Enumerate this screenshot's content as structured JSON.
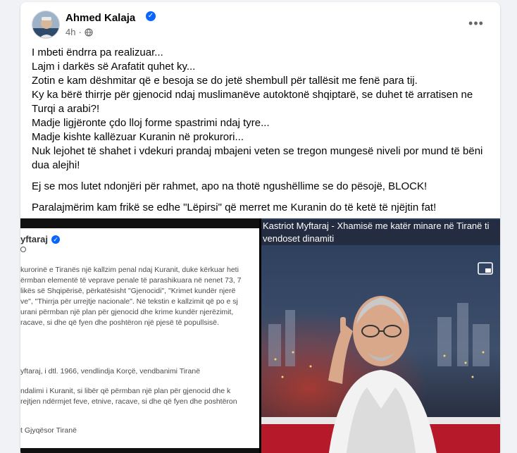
{
  "post": {
    "author": "Ahmed Kalaja",
    "time": "4h",
    "paragraphs": [
      "I mbeti ëndrra pa realizuar...",
      "Lajm i darkës së Arafatit quhet ky...",
      "Zotin e kam dëshmitar që e besoja se do jetë shembull për tallësit me fenë para tij.",
      "Ky ka bërë thirrje për gjenocid ndaj muslimanëve autoktonë shqiptarë, se duhet të arratisen ne Turqi a arabi?!",
      "Madje ligjëronte çdo lloj forme spastrimi ndaj tyre...",
      "Madje kishte kallëzuar Kuranin në prokurori...",
      "Nuk lejohet të shahet i vdekuri prandaj mbajeni veten se tregon mungesë niveli por mund të bëni dua alejhi!"
    ],
    "paragraph_block": "Ej se mos lutet ndonjëri për rahmet, apo na thotë ngushëllime se do pësojë, BLOCK!",
    "paragraph_final": "Paralajmërim kam frikë se edhe \"Lëpirsi\" që merret me Kuranin do të ketë të njëjtin fat!"
  },
  "left_image": {
    "name_fragment": "yftaraj",
    "lines_a": [
      "kurorinë e Tiranës një kallzim penal ndaj Kuranit, duke kërkuar heti",
      "ërmban elementë të veprave penale të parashikuara në nenet 73, 7",
      "likës së Shqipërisë, përkatësisht \"Gjenocidi\", \"Krimet kundër njerë",
      "ve\", \"Thirrja për urrejtje nacionale\". Në tekstin e kallzimit që po e sj",
      "urani përmban një plan për gjenocid dhe krime kundër njerëzimit,",
      "racave, si dhe që fyen dhe poshtëron një pjesë të popullsisë."
    ],
    "line_b": "yftaraj, i dtl. 1966, vendlindja Korçë, vendbanimi Tiranë",
    "lines_c": [
      "ndalimi i Kuranit, si libër që përmban një plan për gjenocid dhe k",
      "rejtjen ndërmjet feve, etnive, racave, si dhe që fyen dhe poshtëron"
    ],
    "line_d": "t Gjyqësor Tiranë"
  },
  "right_image": {
    "caption": "Kastriot Myftaraj - Xhamisë me katër minare në Tiranë ti vendoset dinamiti"
  },
  "icons": {
    "verified": "verified-badge-icon",
    "globe": "globe-icon",
    "more": "more-options-icon",
    "pip": "picture-in-picture-icon"
  },
  "colors": {
    "accent": "#0866ff",
    "secondary_text": "#65676b"
  }
}
